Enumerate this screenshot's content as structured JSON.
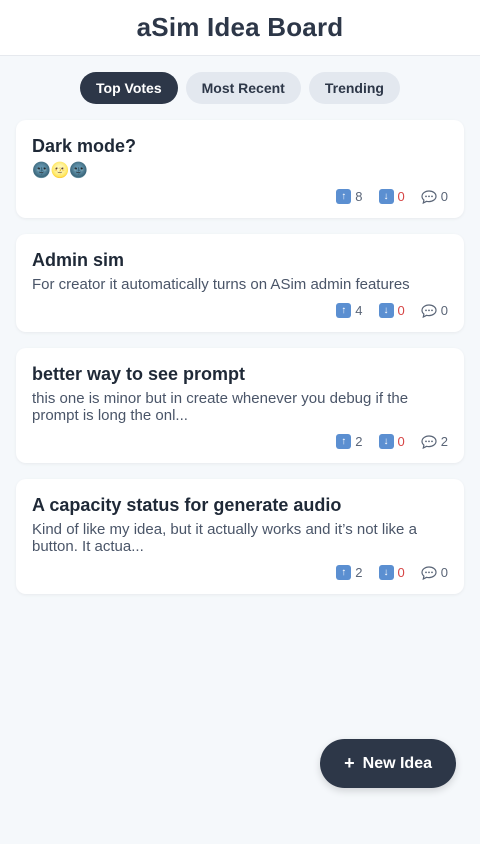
{
  "header": {
    "title": "aSim Idea Board"
  },
  "tabs": [
    {
      "label": "Top Votes",
      "active": true
    },
    {
      "label": "Most Recent",
      "active": false
    },
    {
      "label": "Trending",
      "active": false
    }
  ],
  "ideas": [
    {
      "title": "Dark mode?",
      "description": "🌚🌝🌚",
      "upvotes": "8",
      "downvotes": "0",
      "comments": "0"
    },
    {
      "title": "Admin sim",
      "description": "For creator it automatically turns on ASim admin features",
      "upvotes": "4",
      "downvotes": "0",
      "comments": "0"
    },
    {
      "title": "better way to see prompt",
      "description": "this one is minor but in create whenever you debug if the prompt is long the onl...",
      "upvotes": "2",
      "downvotes": "0",
      "comments": "2"
    },
    {
      "title": "A capacity status for generate audio",
      "description": "Kind of like my idea, but it actually works and it’s not like a button. It actua...",
      "upvotes": "2",
      "downvotes": "0",
      "comments": "0"
    }
  ],
  "fab": {
    "icon": "+",
    "label": "New Idea"
  },
  "icons": {
    "upvote": "up-arrow-icon",
    "downvote": "down-arrow-icon",
    "comment": "speech-bubble-icon"
  },
  "colors": {
    "primary": "#2d3748",
    "background": "#f5f8fb",
    "downvote": "#d64545",
    "vote_icon": "#5b8fd1"
  }
}
